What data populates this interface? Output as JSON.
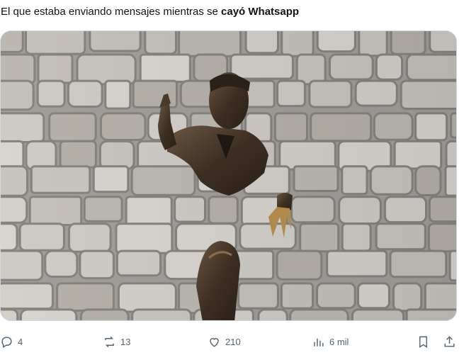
{
  "post": {
    "text_normal": "El que estaba enviando mensajes mientras se ",
    "text_bold": "cayó Whatsapp"
  },
  "media": {
    "alt": "Escultura de bronce de un hombre atravesando un muro de piedra"
  },
  "actions": {
    "reply_count": "4",
    "repost_count": "13",
    "like_count": "210",
    "views_count": "6 mil"
  },
  "colors": {
    "text": "#0f1419",
    "muted": "#536471",
    "border": "#cfd9de",
    "bronze": "#4a3a2a"
  }
}
